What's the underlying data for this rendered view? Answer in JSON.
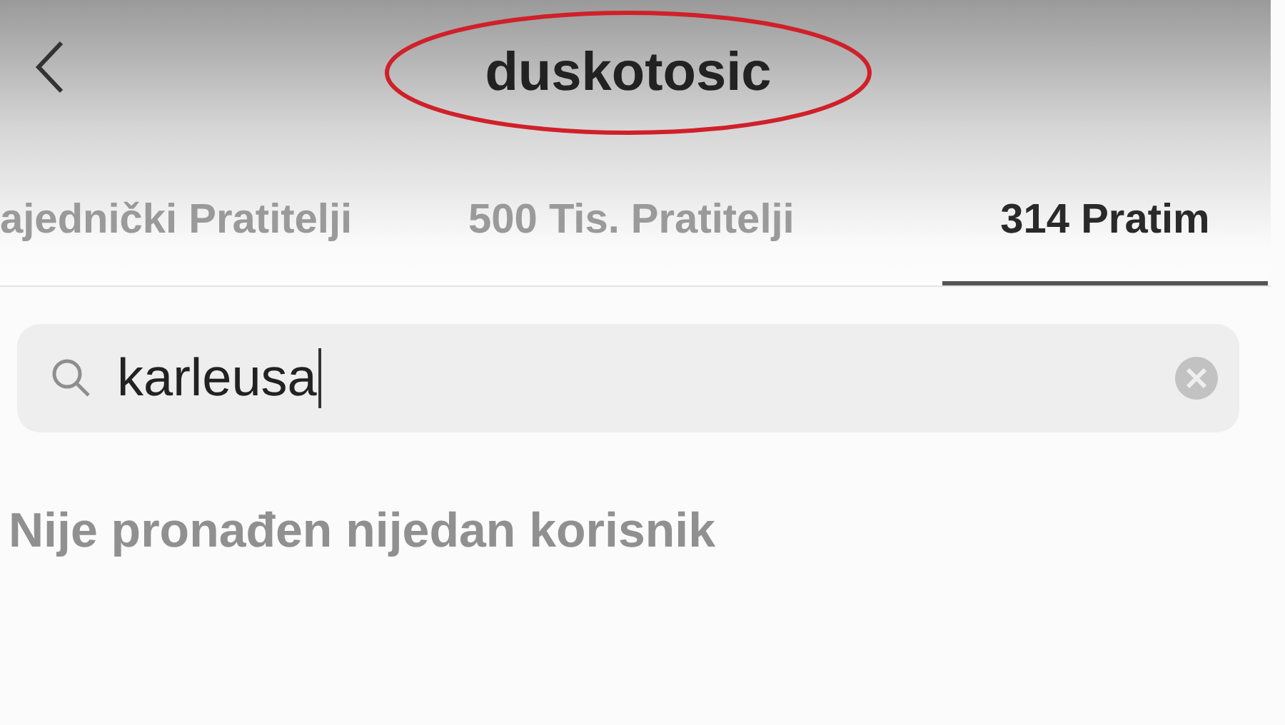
{
  "header": {
    "title": "duskotosic",
    "title_circled": true
  },
  "tabs": [
    {
      "label": "ajednički Pratitelji",
      "selected": false
    },
    {
      "label": "500 Tis. Pratitelji",
      "selected": false
    },
    {
      "label": "314 Pratim",
      "selected": true
    }
  ],
  "search": {
    "value": "karleusa"
  },
  "message": "Nije pronađen nijedan korisnik"
}
